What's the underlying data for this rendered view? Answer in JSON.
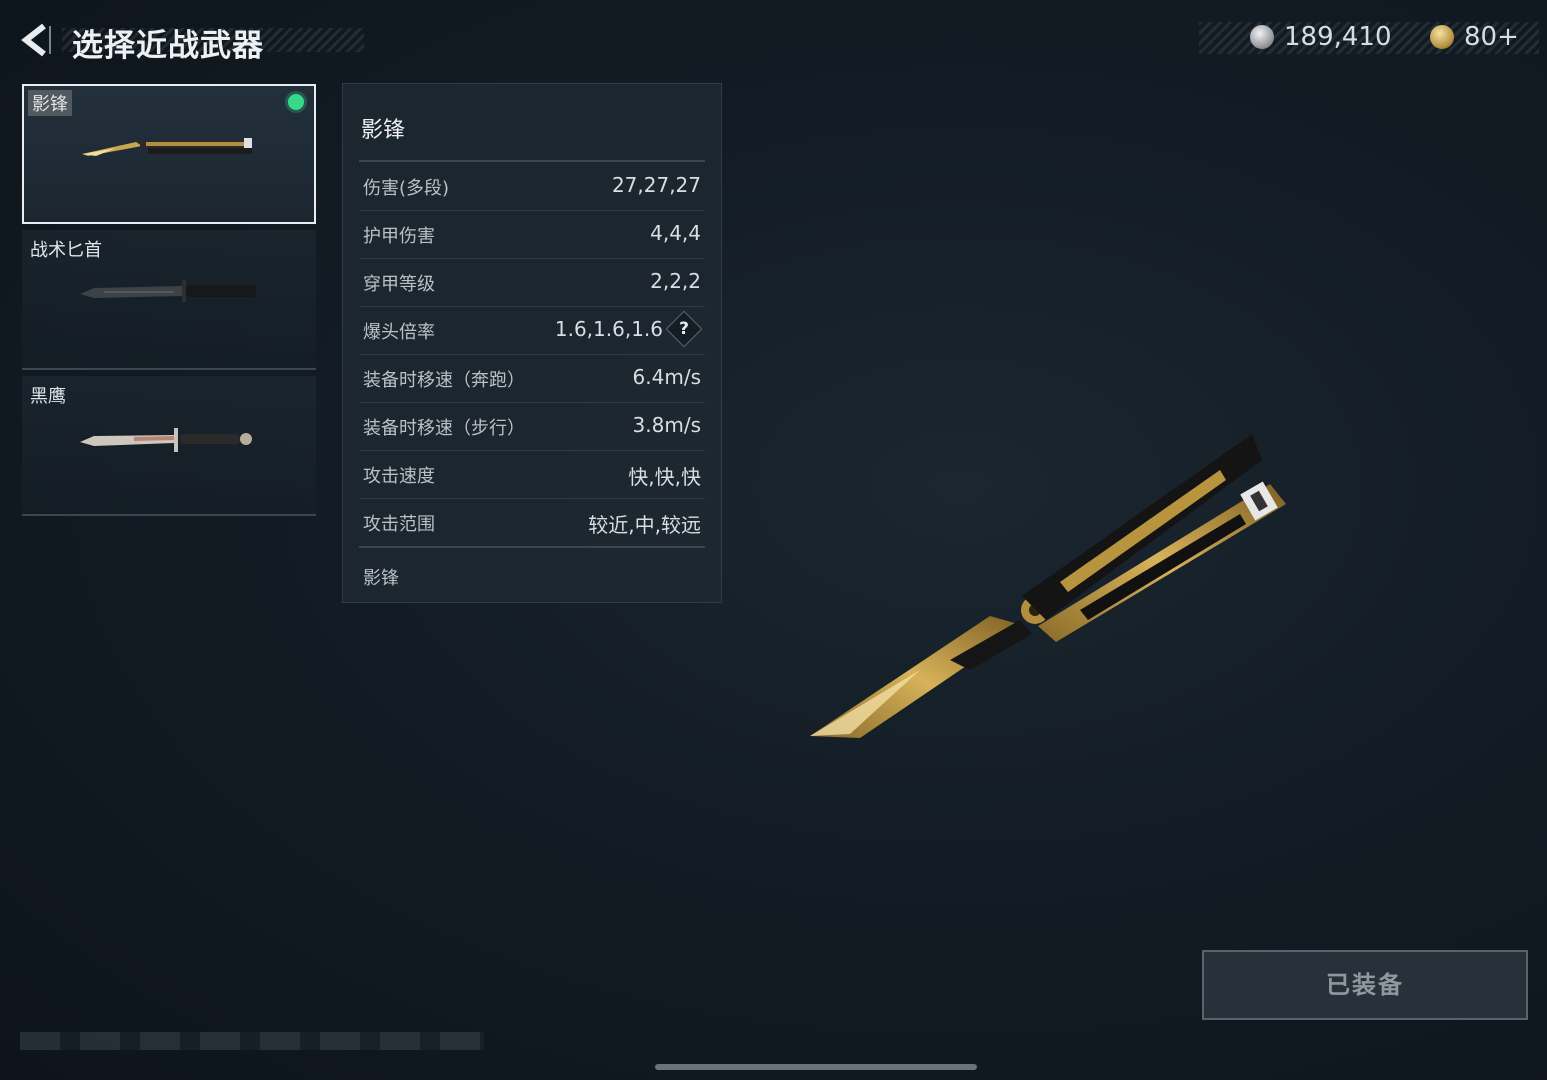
{
  "header": {
    "title": "选择近战武器"
  },
  "currency": {
    "silver": "189,410",
    "gold": "80+"
  },
  "weapons": [
    {
      "name": "影锋",
      "equipped": true
    },
    {
      "name": "战术匕首",
      "equipped": false
    },
    {
      "name": "黑鹰",
      "equipped": false
    }
  ],
  "stats": {
    "name": "影锋",
    "rows": [
      {
        "label": "伤害(多段)",
        "value": "27,27,27"
      },
      {
        "label": "护甲伤害",
        "value": "4,4,4"
      },
      {
        "label": "穿甲等级",
        "value": "2,2,2"
      },
      {
        "label": "爆头倍率",
        "value": "1.6,1.6,1.6"
      },
      {
        "label": "装备时移速（奔跑）",
        "value": "6.4m/s"
      },
      {
        "label": "装备时移速（步行）",
        "value": "3.8m/s"
      },
      {
        "label": "攻击速度",
        "value": "快,快,快"
      },
      {
        "label": "攻击范围",
        "value": "较近,中,较远"
      }
    ],
    "help_label": "?",
    "footer": "影锋"
  },
  "equip_button": {
    "label": "已装备"
  },
  "colors": {
    "equipped_dot": "#39d98a",
    "accent_gold": "#b4913f"
  }
}
